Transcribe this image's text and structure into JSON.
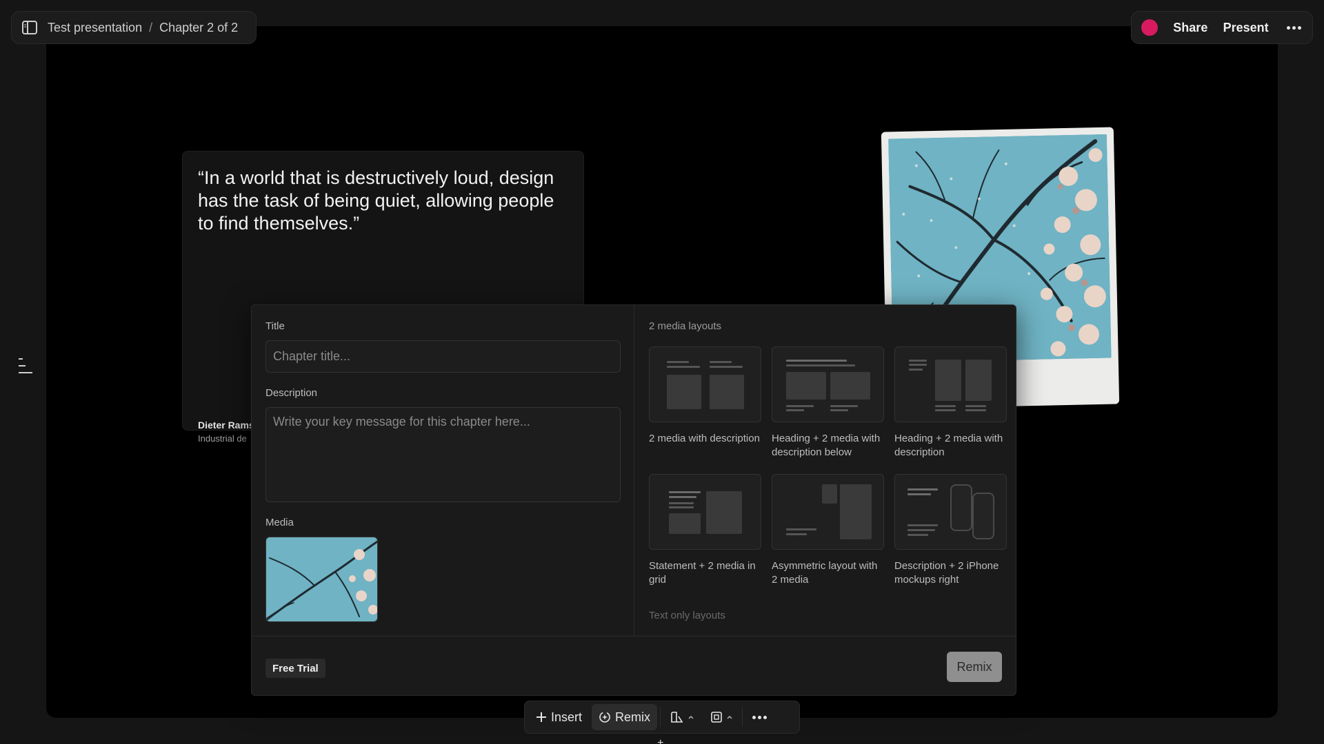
{
  "header": {
    "breadcrumb": [
      "Test presentation",
      "Chapter 2 of 2"
    ],
    "separator": "/",
    "share_label": "Share",
    "present_label": "Present",
    "presence_color": "#d81b60"
  },
  "slide": {
    "quote": "“In a world that is destructively loud, design has the task of being quiet, allowing people to find themselves.”",
    "author_name": "Dieter Rams",
    "author_role": "Industrial de"
  },
  "panel": {
    "title_label": "Title",
    "title_value": "",
    "title_placeholder": "Chapter title...",
    "description_label": "Description",
    "description_value": "",
    "description_placeholder": "Write your key message for this chapter here...",
    "media_label": "Media",
    "layouts_section": "2 media layouts",
    "layouts": [
      {
        "label": "2 media with description"
      },
      {
        "label": "Heading + 2 media with description below"
      },
      {
        "label": "Heading + 2 media with description"
      },
      {
        "label": "Statement + 2 media in grid"
      },
      {
        "label": "Asymmetric layout with 2 media"
      },
      {
        "label": "Description + 2 iPhone mockups right"
      }
    ],
    "next_section": "Text only layouts",
    "free_trial_label": "Free Trial",
    "remix_label": "Remix"
  },
  "toolbar": {
    "insert_label": "Insert",
    "remix_label": "Remix"
  },
  "icons": [
    "sidebar-toggle-icon",
    "more-icon",
    "outline-icon",
    "plus-icon",
    "remix-icon",
    "style-icon",
    "layout-icon",
    "chevron-up-icon"
  ]
}
